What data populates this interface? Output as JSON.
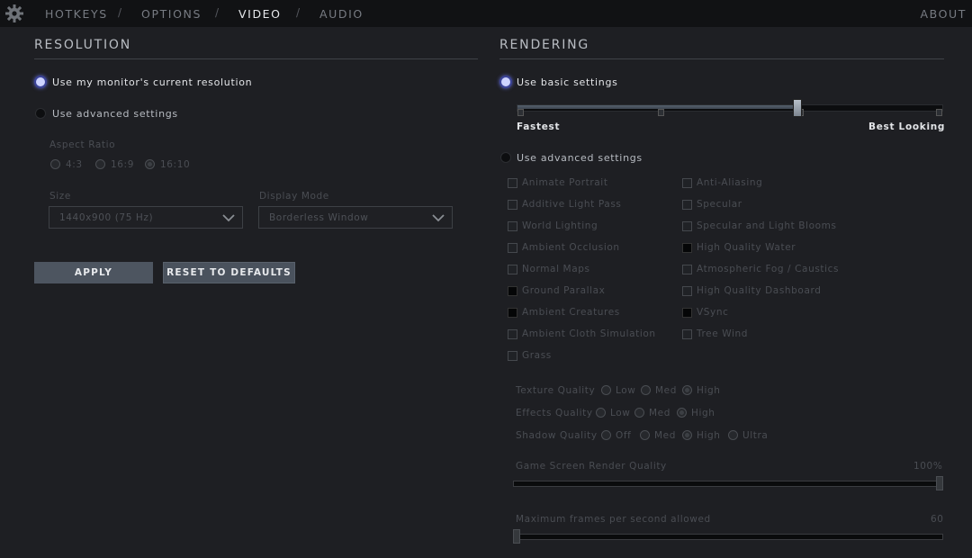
{
  "nav": {
    "tabs": [
      "HOTKEYS",
      "OPTIONS",
      "VIDEO",
      "AUDIO"
    ],
    "separator": "/",
    "active": "VIDEO",
    "about": "ABOUT"
  },
  "resolution": {
    "title": "RESOLUTION",
    "current_label": "Use my monitor's current resolution",
    "advanced_label": "Use advanced settings",
    "aspect_ratio_label": "Aspect Ratio",
    "aspect_options": [
      "4:3",
      "16:9",
      "16:10"
    ],
    "aspect_selected": "16:10",
    "size_label": "Size",
    "size_value": "1440x900 (75 Hz)",
    "display_mode_label": "Display Mode",
    "display_mode_value": "Borderless Window",
    "apply": "APPLY",
    "reset": "RESET TO DEFAULTS"
  },
  "rendering": {
    "title": "RENDERING",
    "basic_label": "Use basic settings",
    "slider_min": "Fastest",
    "slider_max": "Best Looking",
    "slider_value": 0.66,
    "advanced_label": "Use advanced settings",
    "options_left": [
      {
        "label": "Animate Portrait",
        "checked": false
      },
      {
        "label": "Additive Light Pass",
        "checked": false
      },
      {
        "label": "World Lighting",
        "checked": false
      },
      {
        "label": "Ambient Occlusion",
        "checked": false
      },
      {
        "label": "Normal Maps",
        "checked": false
      },
      {
        "label": "Ground Parallax",
        "checked": true
      },
      {
        "label": "Ambient Creatures",
        "checked": true
      },
      {
        "label": "Ambient Cloth Simulation",
        "checked": false
      },
      {
        "label": "Grass",
        "checked": false
      }
    ],
    "options_right": [
      {
        "label": "Anti-Aliasing",
        "checked": false
      },
      {
        "label": "Specular",
        "checked": false
      },
      {
        "label": "Specular and Light Blooms",
        "checked": false
      },
      {
        "label": "High Quality Water",
        "checked": true
      },
      {
        "label": "Atmospheric Fog / Caustics",
        "checked": false
      },
      {
        "label": "High Quality Dashboard",
        "checked": false
      },
      {
        "label": "VSync",
        "checked": true
      },
      {
        "label": "Tree Wind",
        "checked": false
      }
    ],
    "texture_quality": {
      "label": "Texture Quality",
      "options": [
        "Low",
        "Med",
        "High"
      ],
      "selected": "High"
    },
    "effects_quality": {
      "label": "Effects Quality",
      "options": [
        "Low",
        "Med",
        "High"
      ],
      "selected": "High"
    },
    "shadow_quality": {
      "label": "Shadow Quality",
      "options": [
        "Off",
        "Med",
        "High",
        "Ultra"
      ],
      "selected": "High"
    },
    "render_quality": {
      "label": "Game Screen Render Quality",
      "value_text": "100%",
      "value": 1.0
    },
    "max_fps": {
      "label": "Maximum frames per second allowed",
      "value_text": "60",
      "value": 0.0
    }
  }
}
